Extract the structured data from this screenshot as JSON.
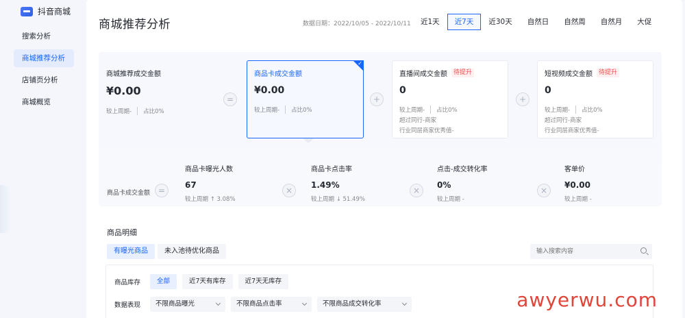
{
  "sidebar": {
    "brand": "抖音商城",
    "items": [
      {
        "label": "搜索分析"
      },
      {
        "label": "商城推荐分析"
      },
      {
        "label": "店铺页分析"
      },
      {
        "label": "商城概览"
      }
    ]
  },
  "header": {
    "title": "商城推荐分析",
    "date_range": "数据日期：2022/10/05 - 2022/10/11",
    "date_tabs": [
      "近1天",
      "近7天",
      "近30天",
      "自然日",
      "自然周",
      "自然月",
      "大促"
    ],
    "active_tab": "近7天"
  },
  "cards": [
    {
      "title": "商城推荐成交金额",
      "value": "¥0.00",
      "sub_a": "较上周期-",
      "sub_b": "占比0%"
    },
    {
      "title": "商品卡成交金额",
      "value": "¥0.00",
      "sub_a": "较上周期-",
      "sub_b": "占比0%"
    },
    {
      "title": "直播间成交金额",
      "badge": "待提升",
      "value": "0",
      "sub_a": "较上周期-",
      "sub_b": "占比0%",
      "line1": "超过同行-商家",
      "line2": "行业同层商家优秀值-"
    },
    {
      "title": "短视频成交金额",
      "badge": "待提升",
      "value": "0",
      "sub_a": "较上周期-",
      "sub_b": "占比0%",
      "line1": "超过同行-商家",
      "line2": "行业同层商家优秀值-"
    }
  ],
  "breakdown": {
    "label": "商品卡成交金额",
    "metrics": [
      {
        "title": "商品卡曝光人数",
        "value": "67",
        "sub": "较上周期 ↑ 3.08%"
      },
      {
        "title": "商品卡点击率",
        "value": "1.49%",
        "sub": "较上周期 ↓ 51.49%"
      },
      {
        "title": "点击-成交转化率",
        "value": "0%",
        "sub": "较上周期 -"
      },
      {
        "title": "客单价",
        "value": "¥0.00",
        "sub": "较上周期 -"
      }
    ]
  },
  "detail": {
    "title": "商品明细",
    "tabs": [
      "有曝光商品",
      "未入池待优化商品"
    ],
    "search_placeholder": "输入搜索内容",
    "stock_label": "商品库存",
    "stock_chips": [
      "全部",
      "近7天有库存",
      "近7天无库存"
    ],
    "perf_label": "数据表现",
    "dropdowns": [
      "不限商品曝光",
      "不限商品点击率",
      "不限商品成交转化率"
    ]
  },
  "watermark": "awyerwu.com",
  "colors": {
    "accent": "#1966ff",
    "warn": "#f04e4e"
  }
}
